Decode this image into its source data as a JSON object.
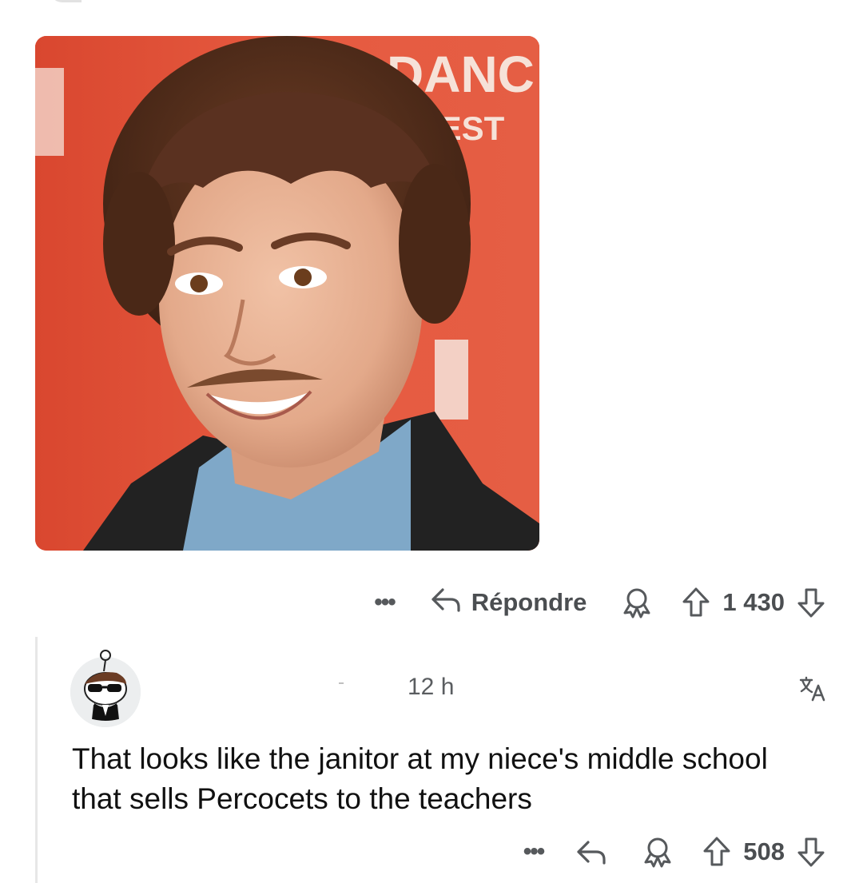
{
  "parent_comment": {
    "media": {
      "alt_semantic": "photo of a smiling man with curly hair at a film festival backdrop",
      "backdrop_text": [
        "DANC",
        "FEST"
      ],
      "backdrop_color": "#e3563f"
    },
    "actions": {
      "more_glyph": "•••",
      "reply_label": "Répondre",
      "vote_count": "1 430",
      "icons": [
        "more-icon",
        "reply-arrow-icon",
        "award-icon",
        "upvote-icon",
        "downvote-icon"
      ]
    }
  },
  "child_comment": {
    "username": "",
    "timestamp": "12 h",
    "body": "That looks like the janitor at my niece's middle school that sells Percocets to the teachers",
    "actions": {
      "more_glyph": "•••",
      "vote_count": "508",
      "icons": [
        "more-icon",
        "reply-arrow-icon",
        "award-icon",
        "upvote-icon",
        "downvote-icon",
        "translate-icon"
      ]
    }
  },
  "colors": {
    "icon_gray": "#56595c",
    "thread_rail": "#e7e7e7",
    "avatar_bg": "#eceeef"
  }
}
